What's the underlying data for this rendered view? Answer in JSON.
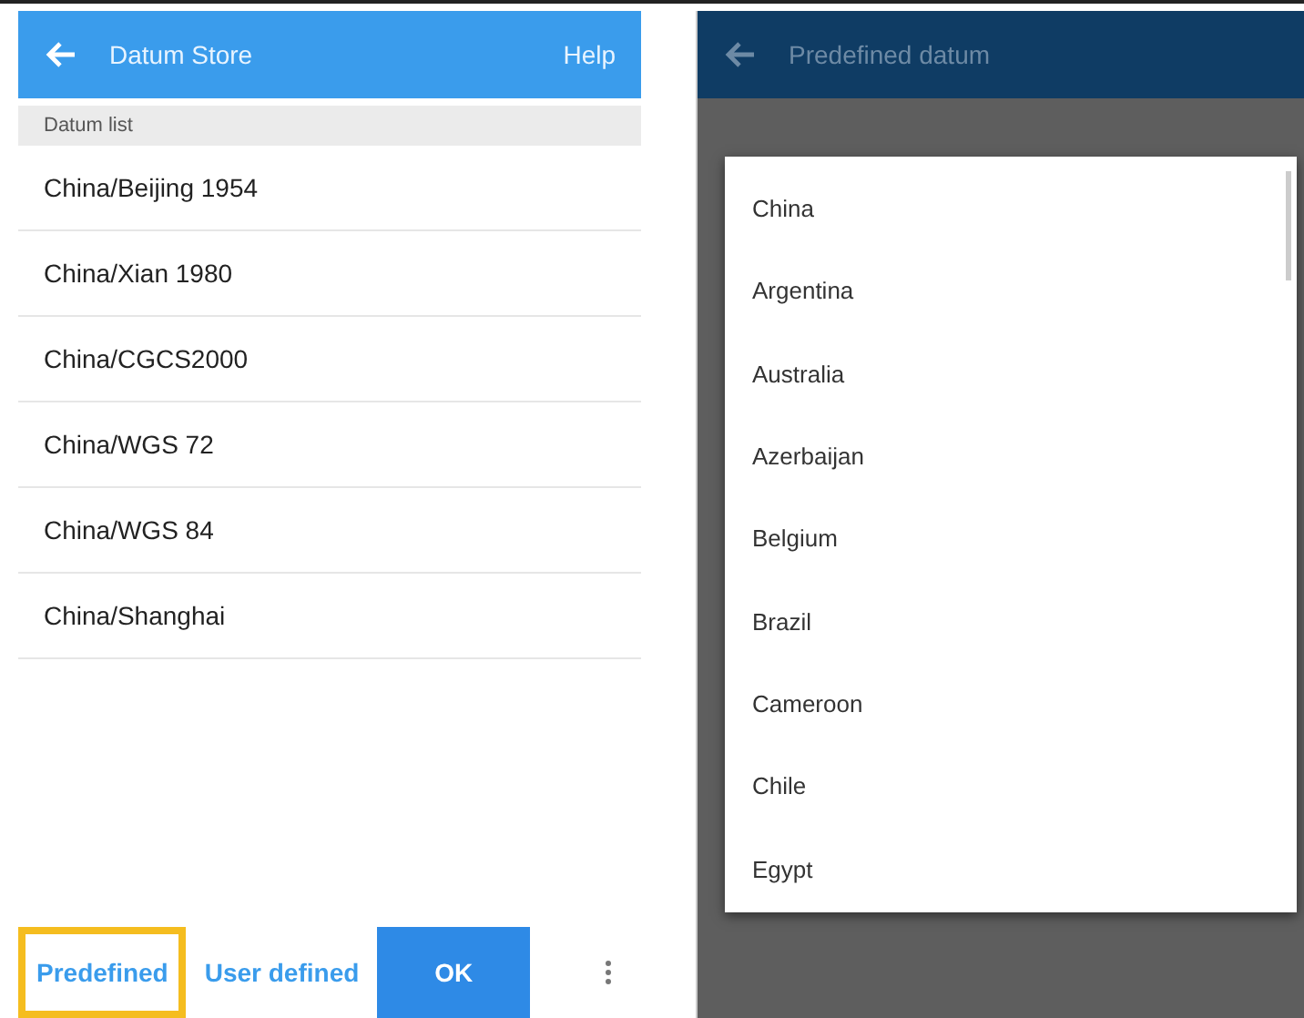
{
  "left_screen": {
    "app_bar": {
      "title": "Datum Store",
      "action": "Help"
    },
    "section_header": "Datum list",
    "datums": [
      "China/Beijing 1954",
      "China/Xian 1980",
      "China/CGCS2000",
      "China/WGS 72",
      "China/WGS 84",
      "China/Shanghai"
    ],
    "tabs": [
      {
        "label": "Predefined",
        "selected": true
      },
      {
        "label": "User defined",
        "selected": false
      }
    ],
    "ok_button": "OK"
  },
  "right_screen": {
    "app_bar": {
      "title": "Predefined datum"
    },
    "country_options": [
      "China",
      "Argentina",
      "Australia",
      "Azerbaijan",
      "Belgium",
      "Brazil",
      "Cameroon",
      "Chile",
      "Egypt"
    ]
  }
}
